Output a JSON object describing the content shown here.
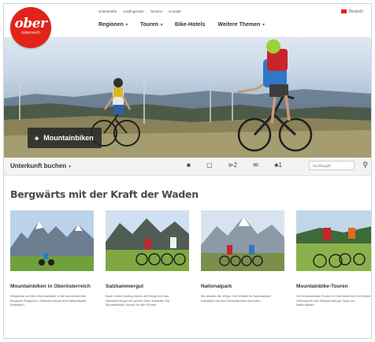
{
  "header": {
    "logo_main": "ober",
    "logo_sub": "österreich",
    "meta_links": [
      "Unterkünfte",
      "Ausflugsziele",
      "Service",
      "Kontakt"
    ],
    "nav": [
      "Regionen",
      "Touren",
      "Bike-Hotels",
      "Weitere Themen"
    ],
    "lang": "Deutsch"
  },
  "hero": {
    "badge_label": "Mountainbiken"
  },
  "booking": {
    "label": "Unterkunft buchen",
    "icons": [
      "camera-icon",
      "map-icon",
      "filter-icon",
      "mail-icon",
      "people-icon"
    ],
    "icon_texts": [
      "■",
      "▢",
      "⊳2",
      "✉",
      "♣1"
    ],
    "search_placeholder": "Suchbegriff"
  },
  "section": {
    "heading": "Bergwärts mit der Kraft der Waden"
  },
  "cards": [
    {
      "title": "Mountainbiken in Oberösterreich",
      "desc": "Bergwärts auf dem Mountainbike in die wunderschöne Bergwelt: Regionen, Salzkammergut und Nationalpark Kalkalpen."
    },
    {
      "title": "Salzkammergut",
      "desc": "Nach einem Ausflug durch die Berge und das Salzkammergut mit seinen Seen erwarten Sie Mountainbike-Touren für alle Könner."
    },
    {
      "title": "Nationalpark",
      "desc": "Bis abseits der Wege: Die Wildnis im Nationalpark Kalkalpen mit dem Mountainbike erkunden."
    },
    {
      "title": "Mountainbike-Touren",
      "desc": "Die Mountainbike-Touren in Oberösterreich mit Karten, Höhenprofil und Salzkammergut Tipps zur Nationalpark."
    }
  ],
  "colors": {
    "brand_red": "#e2231a",
    "text_dark": "#333333",
    "heading_grey": "#4a4a4a"
  }
}
